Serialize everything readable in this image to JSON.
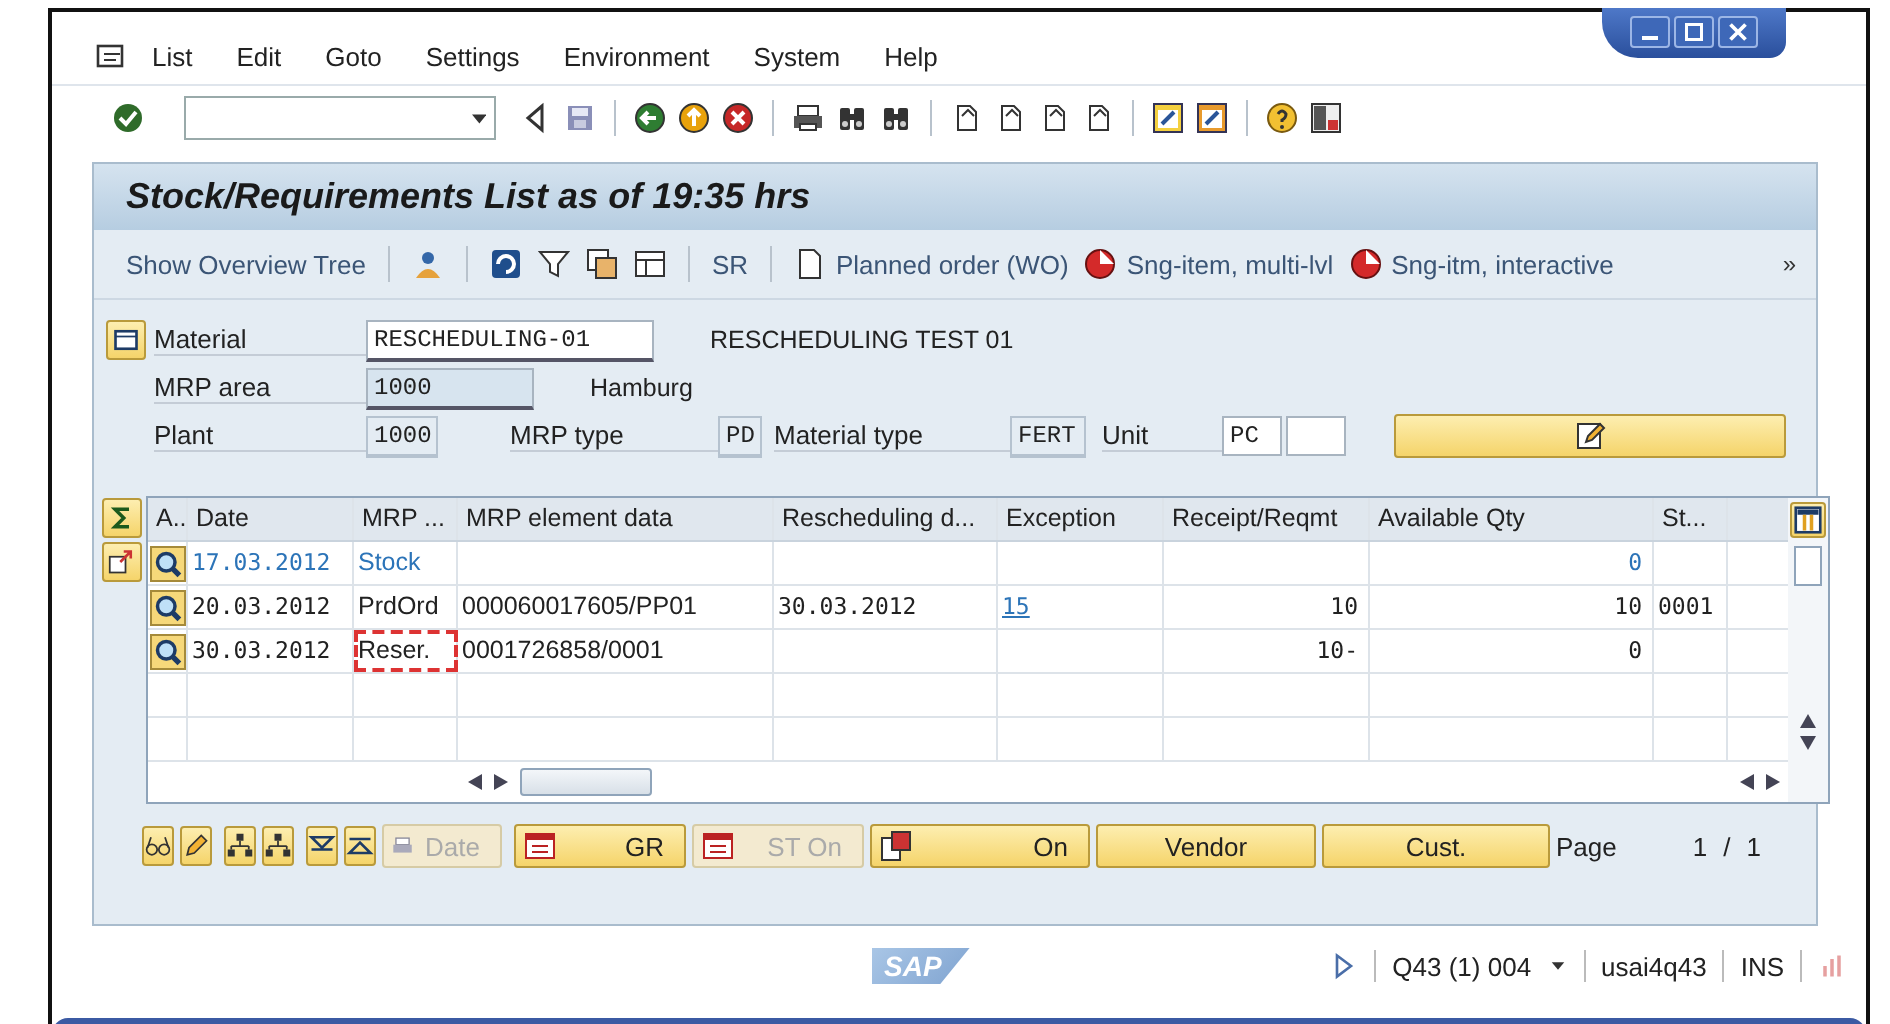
{
  "menu": [
    {
      "label": "List"
    },
    {
      "label": "Edit"
    },
    {
      "label": "Goto"
    },
    {
      "label": "Settings"
    },
    {
      "label": "Environment"
    },
    {
      "label": "System"
    },
    {
      "label": "Help"
    }
  ],
  "title": "Stock/Requirements List as of 19:35 hrs",
  "app_toolbar": [
    {
      "label": "Show Overview Tree"
    },
    {
      "label": "SR"
    },
    {
      "label": "Planned order (WO)"
    },
    {
      "label": "Sng-item, multi-lvl"
    },
    {
      "label": "Sng-itm, interactive"
    }
  ],
  "more": "»",
  "header": {
    "material": {
      "label": "Material",
      "value": "RESCHEDULING-01",
      "description": "RESCHEDULING TEST 01"
    },
    "mrp_area": {
      "label": "MRP area",
      "value": "1000",
      "description": "Hamburg"
    },
    "plant": {
      "label": "Plant",
      "value": "1000"
    },
    "mrp_type": {
      "label": "MRP type",
      "value": "PD"
    },
    "material_type": {
      "label": "Material type",
      "value": "FERT"
    },
    "unit": {
      "label": "Unit",
      "value": "PC"
    }
  },
  "table": {
    "columns": [
      "A..",
      "Date",
      "MRP ...",
      "MRP element data",
      "Rescheduling d...",
      "Exception",
      "Receipt/Reqmt",
      "Available Qty",
      "St..."
    ],
    "rows": [
      {
        "kind": "stock",
        "focused": false,
        "cells": [
          "",
          "17.03.2012",
          "Stock",
          "",
          "",
          "",
          "",
          "0",
          ""
        ]
      },
      {
        "kind": "element",
        "focused": false,
        "cells": [
          "",
          "20.03.2012",
          "PrdOrd",
          "000060017605/PP01",
          "30.03.2012",
          "15",
          "10",
          "10",
          "0001"
        ]
      },
      {
        "kind": "element",
        "focused": true,
        "cells": [
          "",
          "30.03.2012",
          "Reser.",
          "0001726858/0001",
          "",
          "",
          "10-",
          "0",
          ""
        ]
      }
    ]
  },
  "buttons": [
    {
      "kind": "icon-text",
      "label": "Date",
      "disabled": true
    },
    {
      "kind": "icon-text",
      "label": "GR",
      "disabled": false
    },
    {
      "kind": "icon-text",
      "label": "ST On",
      "disabled": true
    },
    {
      "kind": "icon-text",
      "label": "On",
      "disabled": false
    },
    {
      "kind": "text",
      "label": "Vendor",
      "disabled": false
    },
    {
      "kind": "text",
      "label": "Cust.",
      "disabled": false
    }
  ],
  "page": {
    "label": "Page",
    "current": "1",
    "separator": "/",
    "total": "1"
  },
  "status_bar": {
    "logo": "SAP",
    "system": "Q43 (1) 004",
    "user": "usai4q43",
    "mode": "INS"
  }
}
